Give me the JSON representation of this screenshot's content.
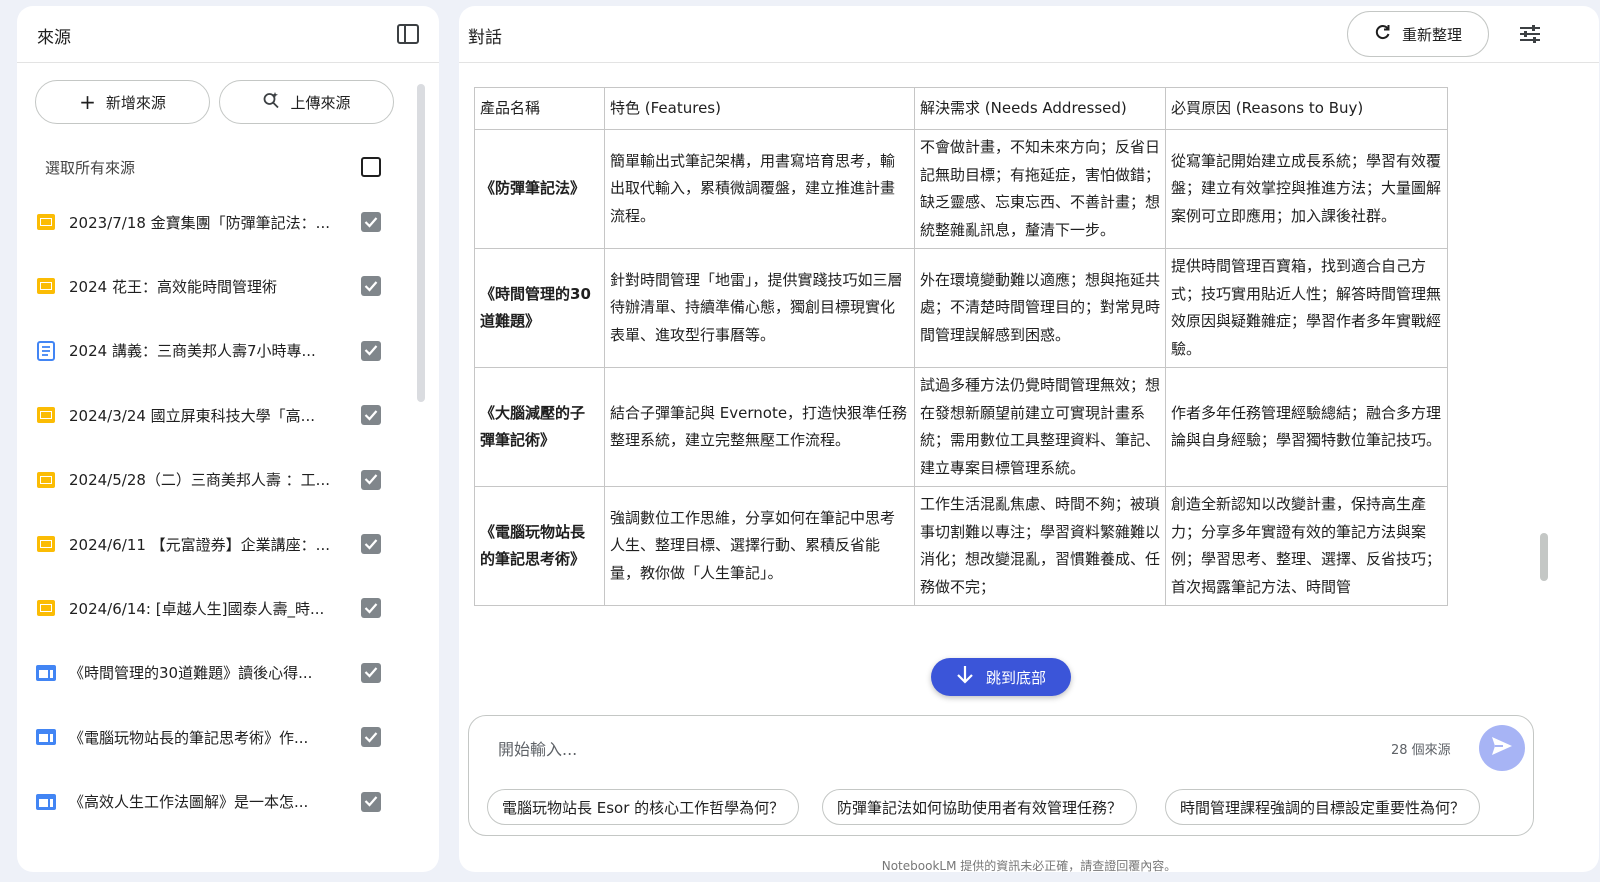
{
  "sources_panel": {
    "title": "來源",
    "add_source_label": "新增來源",
    "upload_source_label": "上傳來源",
    "select_all_label": "選取所有來源",
    "select_all_checked": false,
    "items": [
      {
        "label": "2023/7/18 金寶集團「防彈筆記法：...",
        "icon": "slides-icon",
        "checked": true
      },
      {
        "label": "2024 花王：高效能時間管理術",
        "icon": "slides-icon",
        "checked": true
      },
      {
        "label": "2024 講義：三商美邦人壽7小時專...",
        "icon": "doc-icon",
        "checked": true
      },
      {
        "label": "2024/3/24 國立屏東科技大學「高...",
        "icon": "slides-icon",
        "checked": true
      },
      {
        "label": "2024/5/28（二）三商美邦人壽 ：工...",
        "icon": "slides-icon",
        "checked": true
      },
      {
        "label": "2024/6/11 【元富證券】企業講座：...",
        "icon": "slides-icon",
        "checked": true
      },
      {
        "label": "2024/6/14: [卓越人生]國泰人壽_時...",
        "icon": "slides-icon",
        "checked": true
      },
      {
        "label": "《時間管理的30道難題》讀後心得...",
        "icon": "web-icon",
        "checked": true
      },
      {
        "label": "《電腦玩物站長的筆記思考術》作...",
        "icon": "web-icon",
        "checked": true
      },
      {
        "label": "《高效人生工作法圖解》是一本怎...",
        "icon": "web-icon",
        "checked": true
      }
    ]
  },
  "chat_panel": {
    "title": "對話",
    "refresh_label": "重新整理",
    "table": {
      "headers": [
        "產品名稱",
        "特色 (Features)",
        "解決需求 (Needs Addressed)",
        "必買原因 (Reasons to Buy)"
      ],
      "rows": [
        [
          "《防彈筆記法》",
          "簡單輸出式筆記架構，用書寫培育思考，輸出取代輸入，累積微調覆盤，建立推進計畫流程。",
          "不會做計畫，不知未來方向；反省日記無助目標；有拖延症，害怕做錯；缺乏靈感、忘東忘西、不善計畫；想統整雜亂訊息，釐清下一步。",
          "從寫筆記開始建立成長系統；學習有效覆盤；建立有效掌控與推進方法；大量圖解案例可立即應用；加入課後社群。"
        ],
        [
          "《時間管理的30道難題》",
          "針對時間管理「地雷」，提供實踐技巧如三層待辦清單、持續準備心態，獨創目標現實化表單、進攻型行事曆等。",
          "外在環境變動難以適應；想與拖延共處；不清楚時間管理目的；對常見時間管理誤解感到困惑。",
          "提供時間管理百寶箱，找到適合自己方式；技巧實用貼近人性；解答時間管理無效原因與疑難雜症；學習作者多年實戰經驗。"
        ],
        [
          "《大腦減壓的子彈筆記術》",
          "結合子彈筆記與 Evernote，打造快狠準任務整理系統，建立完整無壓工作流程。",
          "試過多種方法仍覺時間管理無效；想在發想新願望前建立可實現計畫系統；需用數位工具整理資料、筆記、建立專案目標管理系統。",
          "作者多年任務管理經驗總結；融合多方理論與自身經驗；學習獨特數位筆記技巧。"
        ],
        [
          "《電腦玩物站長的筆記思考術》",
          "強調數位工作思維，分享如何在筆記中思考人生、整理目標、選擇行動、累積反省能量，教你做「人生筆記」。",
          "工作生活混亂焦慮、時間不夠；被瑣事切割難以專注；學習資料繁雜難以消化；想改變混亂，習慣難養成、任務做不完；",
          "創造全新認知以改變計畫，保持高生產力；分享多年實證有效的筆記方法與案例；學習思考、整理、選擇、反省技巧；首次揭露筆記方法、時間管"
        ]
      ]
    },
    "jump_to_bottom_label": "跳到底部",
    "composer": {
      "placeholder": "開始輸入...",
      "source_count": "28 個來源"
    },
    "suggestions": [
      "電腦玩物站長 Esor 的核心工作哲學為何？",
      "防彈筆記法如何協助使用者有效管理任務？",
      "時間管理課程強調的目標設定重要性為何？"
    ],
    "footer_note": "NotebookLM 提供的資訊未必正確，請查證回覆內容。"
  }
}
